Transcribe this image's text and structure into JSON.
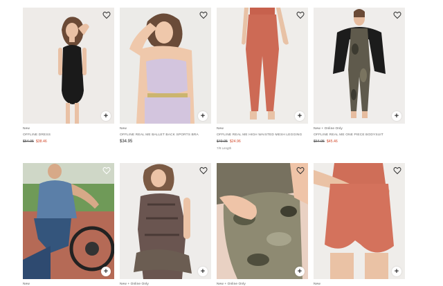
{
  "products": [
    {
      "badge": "New",
      "name": "OFFLINE DRESS",
      "old_price": "$54.95",
      "price": "$38.46"
    },
    {
      "badge": "New",
      "name": "OFFLINE REAL ME BALLET BACK SPORTS BRA",
      "price": "$34.95"
    },
    {
      "badge": "New",
      "name": "OFFLINE REAL ME HIGH WAISTED MESH LEGGING",
      "old_price": "$49.95",
      "price": "$24.96",
      "extra": "7/8 Length"
    },
    {
      "badge": "New + Online Only",
      "name": "OFFLINE REAL ME ONE PIECE BODYSUIT",
      "old_price": "$64.95",
      "price": "$45.46"
    },
    {
      "badge": "New"
    },
    {
      "badge": "New + Online Only"
    },
    {
      "badge": "New + Online Only"
    },
    {
      "badge": "New"
    }
  ],
  "icons": {
    "wishlist": "heart-icon",
    "add": "plus-icon"
  },
  "colors": {
    "sale": "#d2492a",
    "background": "#ffffff"
  }
}
